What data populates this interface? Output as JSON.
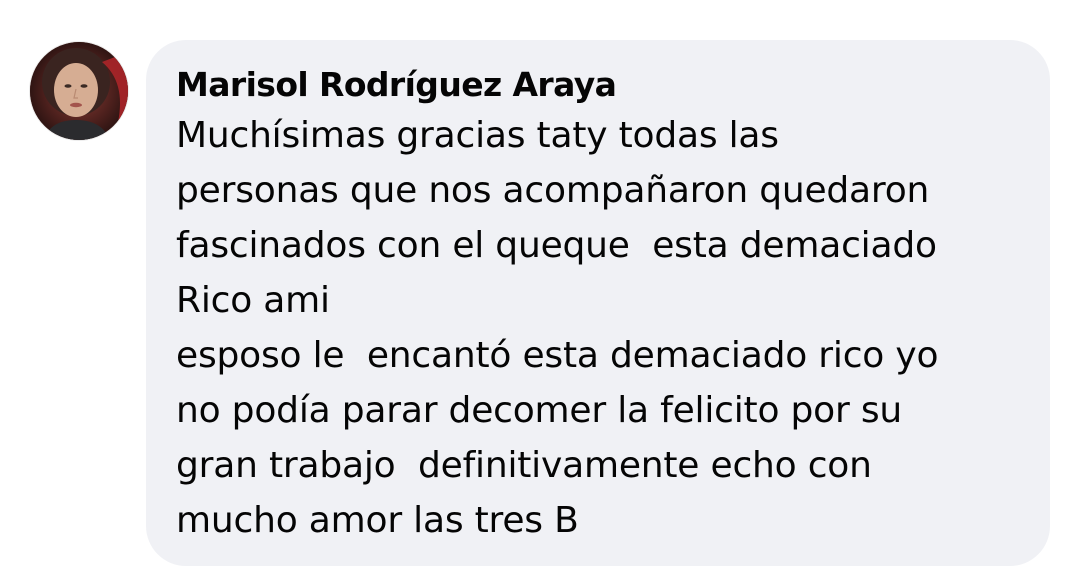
{
  "comment": {
    "author": "Marisol Rodríguez Araya",
    "text": "Muchísimas gracias taty todas las\npersonas que nos acompañaron quedaron\nfascinados con el queque  esta demaciado\nRico ami\nesposo le  encantó esta demaciado rico yo\nno podía parar decomer la felicito por su\ngran trabajo  definitivamente echo con\nmucho amor las tres B"
  },
  "colors": {
    "bubble_background": "#f0f1f5",
    "text": "#050505",
    "page_background": "#ffffff"
  }
}
